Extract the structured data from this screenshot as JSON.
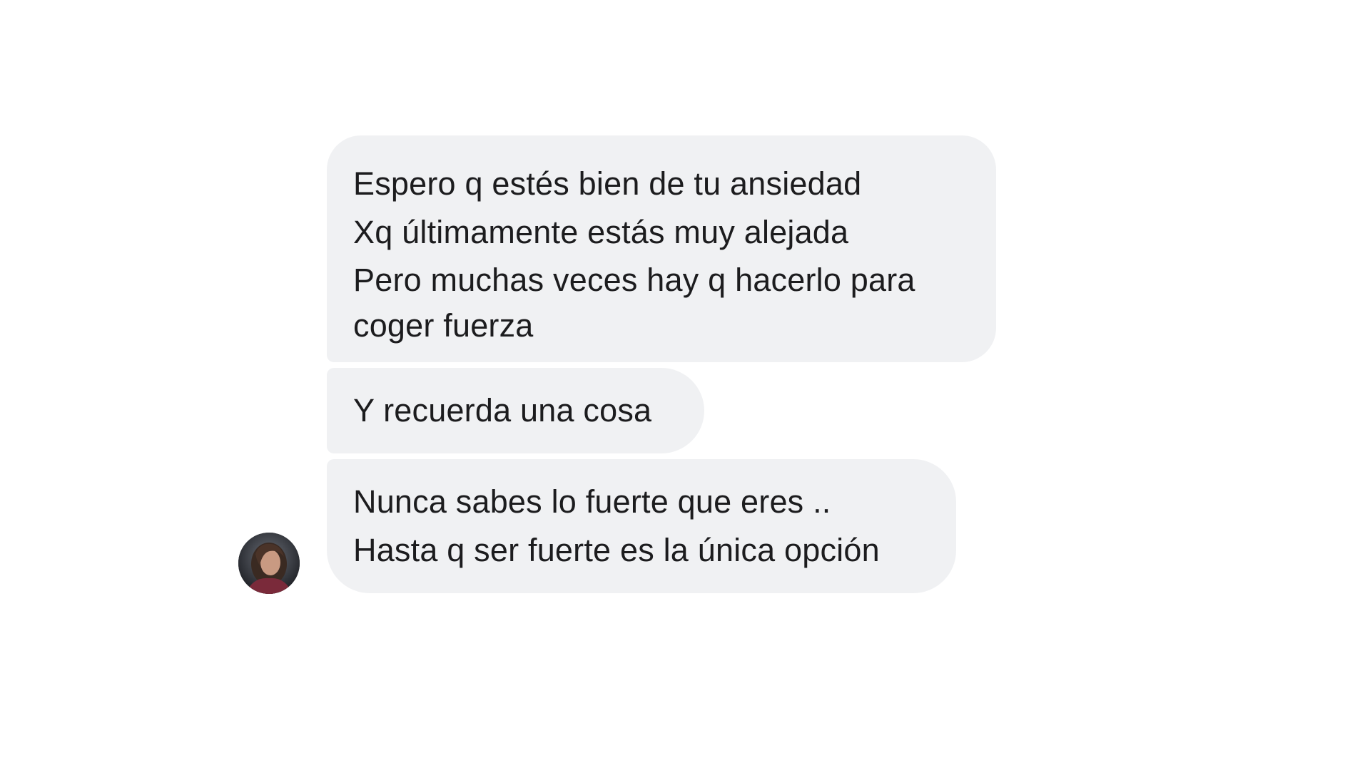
{
  "messages": [
    {
      "lines": [
        "Espero q estés bien de tu ansiedad",
        "Xq últimamente estás muy alejada",
        "Pero muchas veces hay q hacerlo para",
        "coger fuerza"
      ]
    },
    {
      "lines": [
        "Y recuerda una cosa"
      ]
    },
    {
      "lines": [
        "Nunca sabes lo fuerte que eres ..",
        "Hasta q ser fuerte es la única opción"
      ]
    }
  ],
  "colors": {
    "background": "#ffffff",
    "bubble": "#f0f1f3",
    "text": "#1c1c1e"
  },
  "avatar": {
    "icon": "contact-avatar-photo"
  }
}
